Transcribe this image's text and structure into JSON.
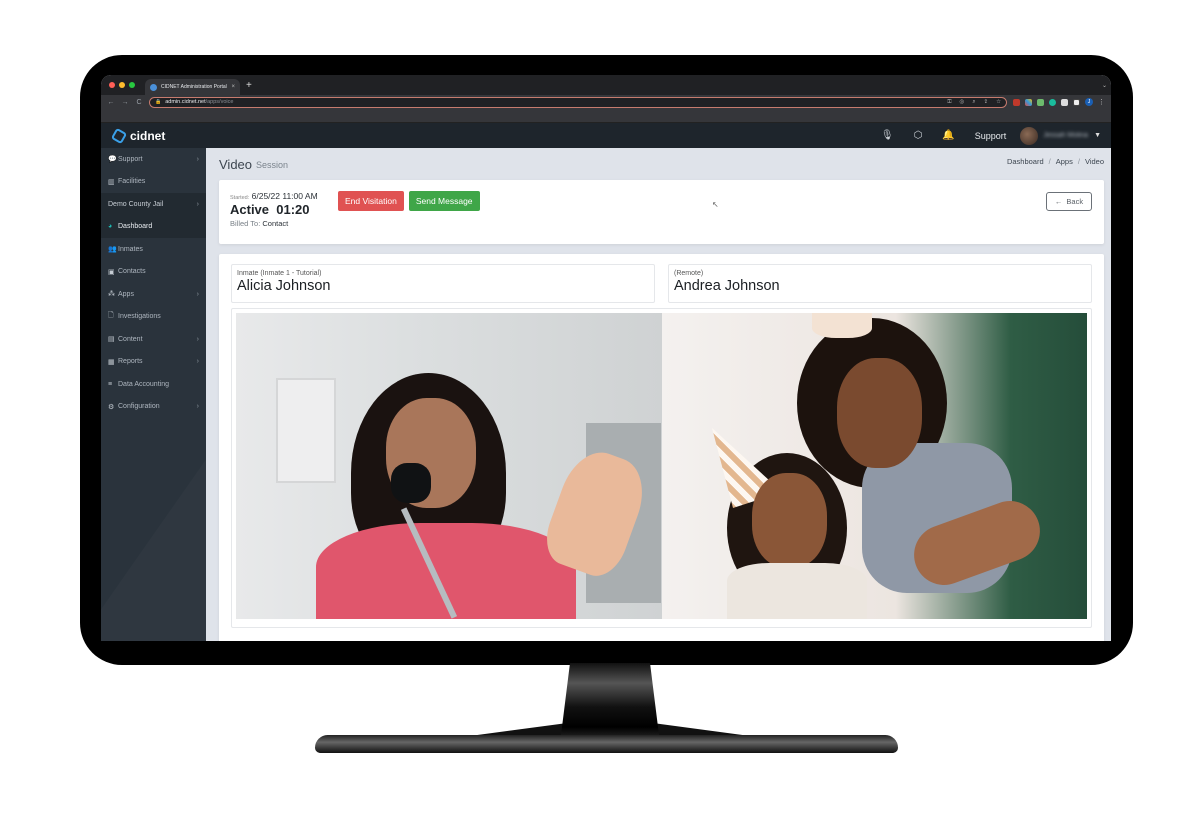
{
  "browser": {
    "tab_title": "CIDNET Administration Portal",
    "tab_close": "×",
    "new_tab": "+",
    "url_host": "admin.cidnet.net",
    "url_path": "/apps/voice",
    "nav": {
      "back": "←",
      "forward": "→",
      "reload": "C"
    },
    "lock": "🔒",
    "omni_icons": [
      "key-icon",
      "translate-icon",
      "zoom-icon",
      "share-icon",
      "star-icon"
    ],
    "profile_initial": "J",
    "menu": "⋮",
    "tab_search": "⌄"
  },
  "header": {
    "logo_text": "cidnet",
    "support_label": "Support",
    "user_name": "Jessah Molina",
    "caret": "▼",
    "icons": {
      "mic": "🎙",
      "cube": "⬡",
      "bell": "🔔"
    }
  },
  "sidebar": {
    "items": [
      {
        "label": "Support",
        "icon": "💬",
        "chevron": "›"
      },
      {
        "label": "Facilities",
        "icon": "▥",
        "chevron": ""
      },
      {
        "label": "Demo County Jail",
        "icon": "",
        "chevron": "›"
      },
      {
        "label": "Dashboard",
        "icon": "◕",
        "chevron": ""
      },
      {
        "label": "Inmates",
        "icon": "👥",
        "chevron": ""
      },
      {
        "label": "Contacts",
        "icon": "▣",
        "chevron": ""
      },
      {
        "label": "Apps",
        "icon": "⁂",
        "chevron": "›"
      },
      {
        "label": "Investigations",
        "icon": "🗋",
        "chevron": ""
      },
      {
        "label": "Content",
        "icon": "▤",
        "chevron": "›"
      },
      {
        "label": "Reports",
        "icon": "▦",
        "chevron": "›"
      },
      {
        "label": "Data Accounting",
        "icon": "≡",
        "chevron": ""
      },
      {
        "label": "Configuration",
        "icon": "⚙",
        "chevron": "›"
      }
    ]
  },
  "page": {
    "title": "Video",
    "subtitle": "Session",
    "breadcrumb": [
      "Dashboard",
      "Apps",
      "Video"
    ],
    "crumb_sep": "/"
  },
  "session": {
    "started_label": "Started:",
    "started_value": "6/25/22 11:00 AM",
    "status": "Active",
    "elapsed": "01:20",
    "billed_label": "Billed To:",
    "billed_value": "Contact",
    "end_button": "End Visitation",
    "message_button": "Send Message",
    "back_button": "Back",
    "back_arrow": "←",
    "cursor": "↖",
    "colors": {
      "danger": "#e05252",
      "success": "#3fa648"
    }
  },
  "parties": {
    "inmate": {
      "label": "Inmate (Inmate 1 - Tutorial)",
      "name": "Alicia Johnson"
    },
    "remote": {
      "label": "(Remote)",
      "name": "Andrea Johnson"
    }
  }
}
